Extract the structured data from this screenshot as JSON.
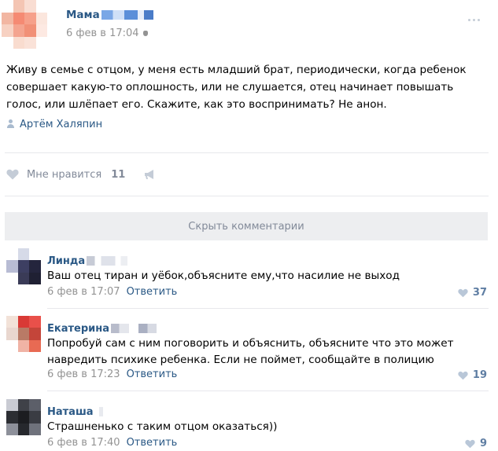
{
  "post": {
    "author": "Мама",
    "date": "6 фев в 17:04",
    "text": "Живу в семье с отцом, у меня есть младший брат, периодически, когда ребенок совершает какую-то оплошность, или не слушается, отец начинает повышать голос, или шлёпает его. Скажите, как это воспринимать? Не анон.",
    "signer": "Артём Халяпин",
    "like_label": "Мне нравится",
    "like_count": "11"
  },
  "hide_comments_label": "Скрыть комментарии",
  "comments": [
    {
      "name": "Линда",
      "text": "Ваш отец тиран и уёбок,объясните ему,что насилие не выход",
      "date": "6 фев в 17:07",
      "reply": "Ответить",
      "likes": "37"
    },
    {
      "name": "Екатерина",
      "text": "Попробуй сам с ним поговорить и объяснить, объясните что это может навредить психике ребенка. Если не поймет, сообщайте в полицию",
      "date": "6 фев в 17:23",
      "reply": "Ответить",
      "likes": "19"
    },
    {
      "name": "Наташа",
      "text": "Страшненько с таким отцом оказаться))",
      "date": "6 фев в 17:40",
      "reply": "Ответить",
      "likes": "9"
    }
  ],
  "colors": {
    "link": "#2a5885",
    "muted": "#939393",
    "like_muted": "#828a99",
    "like_active": "#5f7ea3",
    "bar_bg": "#edeef0"
  }
}
